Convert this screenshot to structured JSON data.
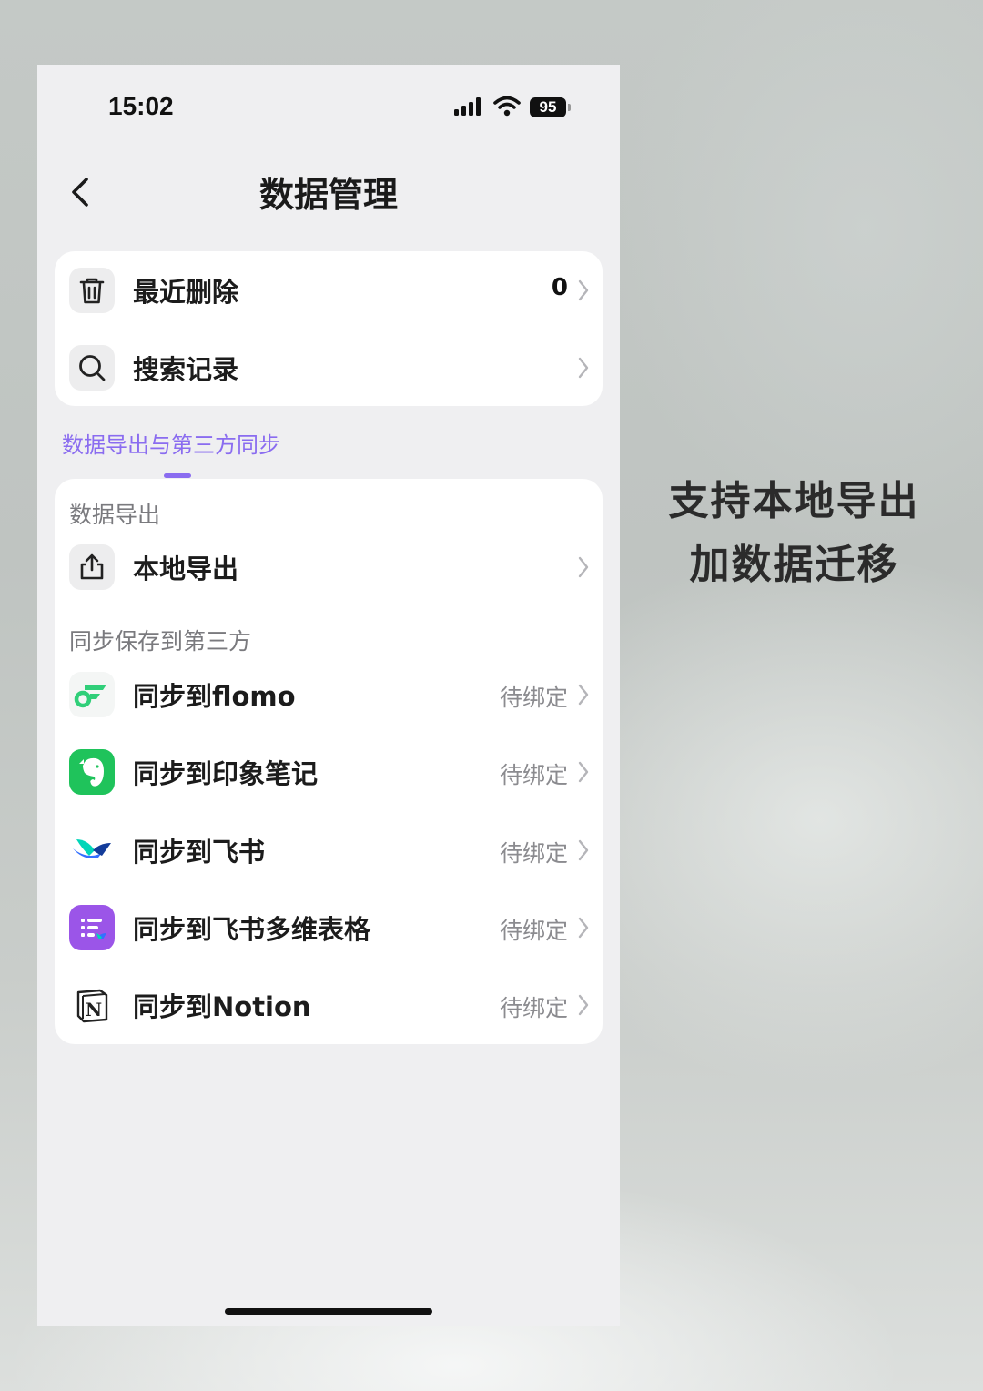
{
  "status_bar": {
    "time": "15:02",
    "battery": "95"
  },
  "header": {
    "title": "数据管理"
  },
  "top_card": [
    {
      "label": "最近删除",
      "value": "0",
      "icon": "trash-icon"
    },
    {
      "label": "搜索记录",
      "value": "",
      "icon": "search-icon"
    }
  ],
  "section_tab": "数据导出与第三方同步",
  "export_group": {
    "header": "数据导出",
    "items": [
      {
        "label": "本地导出",
        "icon": "share-export-icon"
      }
    ]
  },
  "sync_group": {
    "header": "同步保存到第三方",
    "items": [
      {
        "label": "同步到flomo",
        "value": "待绑定",
        "icon": "flomo-logo-icon"
      },
      {
        "label": "同步到印象笔记",
        "value": "待绑定",
        "icon": "evernote-logo-icon"
      },
      {
        "label": "同步到飞书",
        "value": "待绑定",
        "icon": "feishu-logo-icon"
      },
      {
        "label": "同步到飞书多维表格",
        "value": "待绑定",
        "icon": "feishu-bitable-logo-icon"
      },
      {
        "label": "同步到Notion",
        "value": "待绑定",
        "icon": "notion-logo-icon"
      }
    ]
  },
  "caption": {
    "line1": "支持本地导出",
    "line2": "加数据迁移"
  },
  "colors": {
    "accent": "#8a6cf0",
    "background": "#efeff1",
    "card": "#ffffff"
  }
}
